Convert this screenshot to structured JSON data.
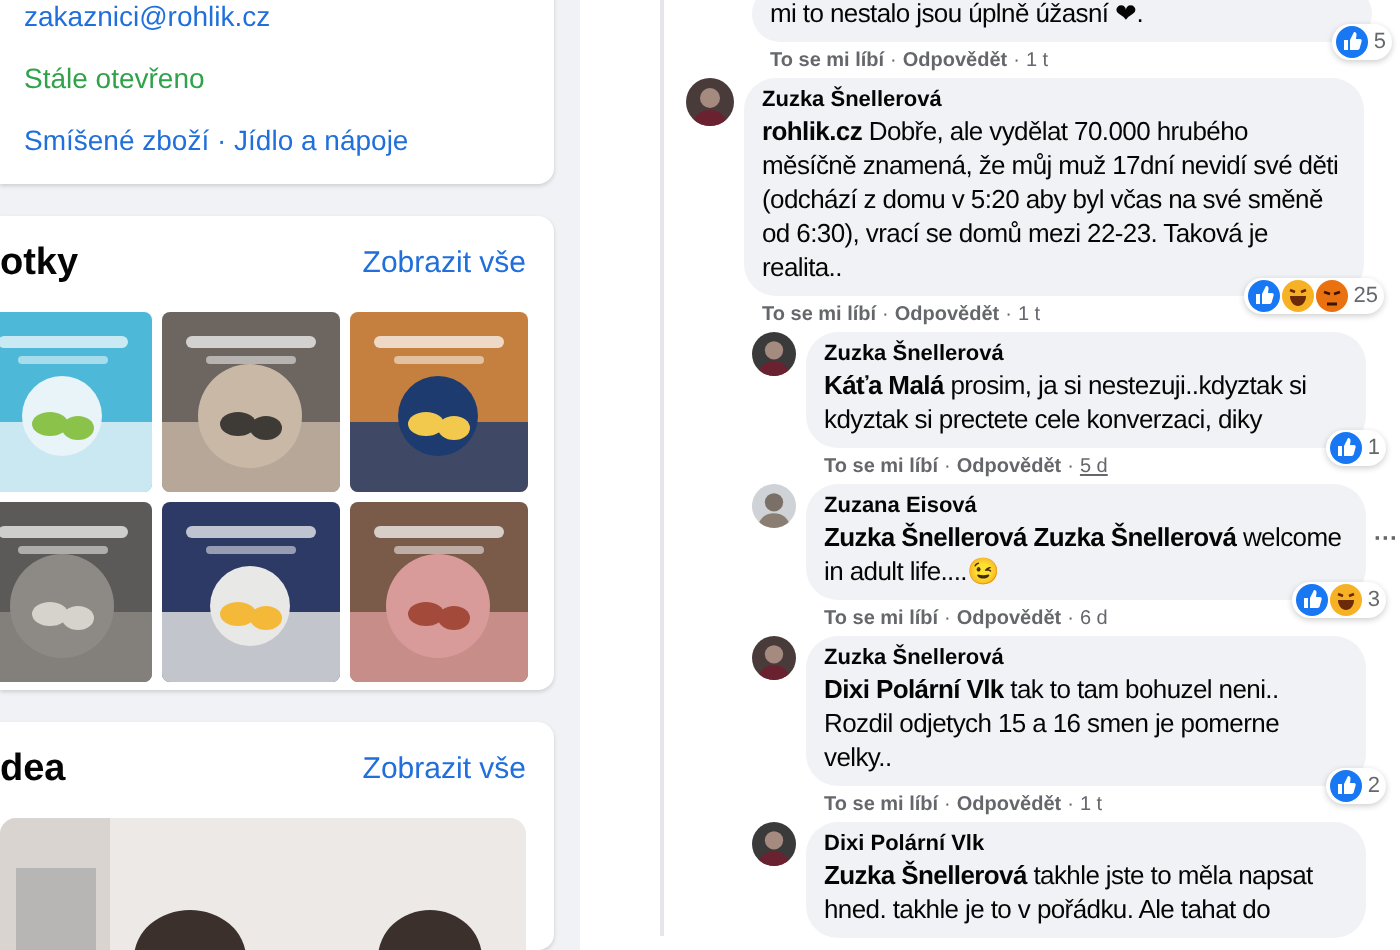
{
  "about": {
    "email": "zakaznici@rohlik.cz",
    "hours": "Stále otevřeno",
    "category": "Smíšené zboží · Jídlo a nápoje"
  },
  "photos": {
    "title": "otky",
    "link": "Zobrazit vše"
  },
  "videos": {
    "title": "dea",
    "link": "Zobrazit vše"
  },
  "action_separator": "·",
  "cut_comment": {
    "text": "mi to nestalo jsou úplně úžasní ❤.",
    "actions": [
      "To se mi líbí",
      "Odpovědět"
    ],
    "time": "1 t",
    "time_underlined": false,
    "reactions": {
      "icons": [
        {
          "kind": "like"
        }
      ],
      "count": "5"
    }
  },
  "thread": {
    "author": "Zuzka Šnellerová",
    "text": "**rohlik.cz** Dobře, ale vydělat 70.000 hrubého měsíčně znamená, že můj muž 17dní nevidí své děti (odchází z domu v 5:20 aby byl včas na své směně od 6:30), vrací se domů mezi 22-23. Taková je realita..",
    "actions": [
      "To se mi líbí",
      "Odpovědět"
    ],
    "time": "1 t",
    "time_underlined": false,
    "reactions": {
      "icons": [
        {
          "kind": "like"
        },
        {
          "kind": "haha"
        },
        {
          "kind": "angry"
        }
      ],
      "count": "25"
    },
    "children": [
      {
        "author": "Zuzka Šnellerová",
        "text": "**Káťa Malá** prosim, ja si nestezuji..kdyztak si kdyztak si prectete cele konverzaci, diky",
        "actions": [
          "To se mi líbí",
          "Odpovědět"
        ],
        "time": "5 d",
        "time_underlined": true,
        "reactions": {
          "icons": [
            {
              "kind": "like"
            }
          ],
          "count": "1"
        }
      },
      {
        "author": "Zuzana Eisová",
        "text": "**Zuzka Šnellerová** **Zuzka Šnellerová** welcome in adult life....😉",
        "actions": [
          "To se mi líbí",
          "Odpovědět"
        ],
        "time": "6 d",
        "time_underlined": false,
        "reactions": {
          "icons": [
            {
              "kind": "like"
            },
            {
              "kind": "haha"
            }
          ],
          "count": "3"
        },
        "more": "···"
      },
      {
        "author": "Zuzka Šnellerová",
        "text": "**Dixi Polární Vlk** tak to tam bohuzel neni.. Rozdil odjetych 15 a 16 smen je pomerne velky..",
        "actions": [
          "To se mi líbí",
          "Odpovědět"
        ],
        "time": "1 t",
        "time_underlined": false,
        "reactions": {
          "icons": [
            {
              "kind": "like"
            }
          ],
          "count": "2"
        }
      },
      {
        "author": "Dixi Polární Vlk",
        "text": "**Zuzka Šnellerová** takhle jste to měla napsat hned. takhle je to v pořádku. Ale tahat do"
      }
    ]
  }
}
